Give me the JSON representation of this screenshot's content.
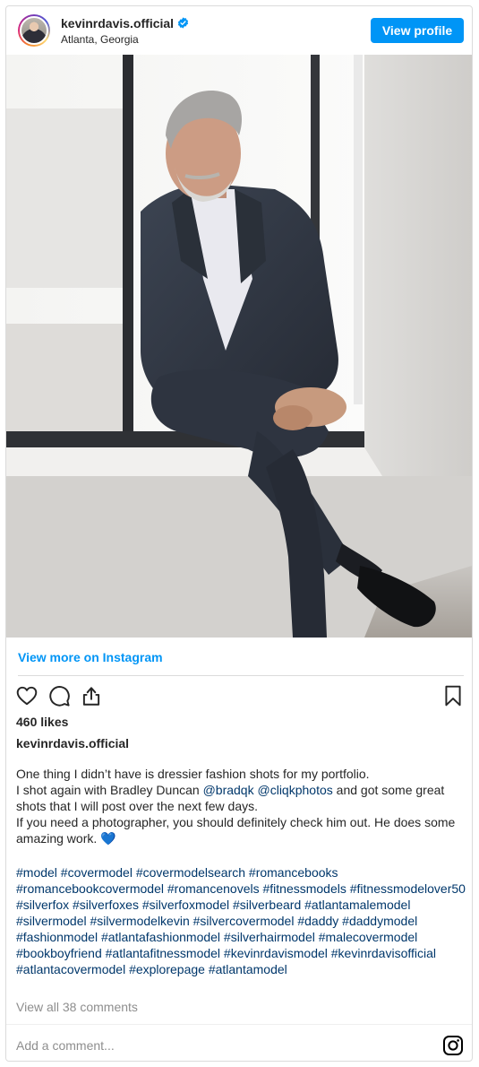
{
  "post": {
    "username": "kevinrdavis.official",
    "location": "Atlanta, Georgia",
    "view_profile_label": "View profile",
    "view_more_label": "View more on Instagram",
    "likes": "460 likes",
    "caption_username": "kevinrdavis.official",
    "caption_line1": "One thing I didn’t have is dressier fashion shots for my portfolio.",
    "caption_line2a": "I shot again with Bradley Duncan ",
    "mention1": "@bradqk",
    "mention_sep": " ",
    "mention2": "@cliqkphotos",
    "caption_line2b": " and got some great shots that I will post over the next few days.",
    "caption_line3": "If you need a photographer, you should definitely check him out. He does some amazing work. 💙",
    "hashtags": "#model #covermodel #covermodelsearch #romancebooks #romancebookcovermodel #romancenovels #fitnessmodels #fitnessmodelover50 #silverfox #silverfoxes #silverfoxmodel #silverbeard #atlantamalemodel #silvermodel #silvermodelkevin #silvercovermodel #daddy #daddymodel #fashionmodel #atlantafashionmodel #silverhairmodel #malecovermodel #bookboyfriend #atlantafitnessmodel #kevinrdavismodel #kevinrdavisofficial #atlantacovermodel #explorepage #atlantamodel",
    "view_comments": "View all 38 comments",
    "add_comment_placeholder": "Add a comment..."
  },
  "icons": {
    "verified": "verified-badge-icon",
    "like": "heart-icon",
    "comment": "comment-icon",
    "share": "share-icon",
    "save": "bookmark-icon",
    "instagram": "instagram-icon"
  },
  "colors": {
    "accent": "#0095f6",
    "link": "#00376b",
    "muted": "#8e8e8e",
    "text": "#262626",
    "border": "#dbdbdb"
  }
}
